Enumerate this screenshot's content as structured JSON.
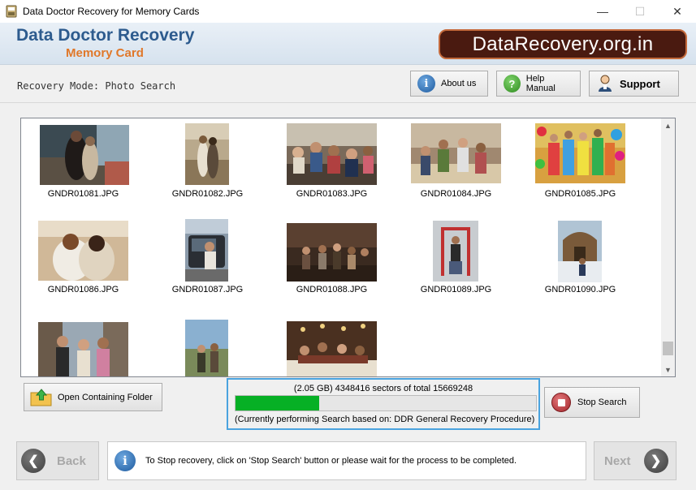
{
  "window": {
    "title": "Data Doctor Recovery for Memory Cards",
    "minimize": "—",
    "maximize": "☐",
    "close": "✕"
  },
  "header": {
    "brand_line1": "Data Doctor Recovery",
    "brand_line2": "Memory Card",
    "site_badge": "DataRecovery.org.in",
    "colors": {
      "brand_blue": "#2d5b8e",
      "brand_orange": "#e0782a",
      "badge_bg": "#4a1a10"
    }
  },
  "mode": {
    "label": "Recovery Mode: Photo Search"
  },
  "toolbar": {
    "about_label": "About us",
    "help_label": "Help Manual",
    "support_label": "Support",
    "about_icon": "info-icon",
    "help_icon": "question-icon",
    "support_icon": "person-icon"
  },
  "gallery": {
    "files": [
      {
        "name": "GNDR01081.JPG"
      },
      {
        "name": "GNDR01082.JPG"
      },
      {
        "name": "GNDR01083.JPG"
      },
      {
        "name": "GNDR01084.JPG"
      },
      {
        "name": "GNDR01085.JPG"
      },
      {
        "name": "GNDR01086.JPG"
      },
      {
        "name": "GNDR01087.JPG"
      },
      {
        "name": "GNDR01088.JPG"
      },
      {
        "name": "GNDR01089.JPG"
      },
      {
        "name": "GNDR01090.JPG"
      },
      {
        "name": ""
      },
      {
        "name": ""
      },
      {
        "name": ""
      }
    ],
    "scroll_up": "▲",
    "scroll_down": "▼"
  },
  "actions": {
    "open_folder_label": "Open Containing Folder",
    "stop_label": "Stop Search"
  },
  "progress": {
    "stats_text": "(2.05 GB) 4348416  sectors  of  total  15669248",
    "status_text": "(Currently performing Search based on:  DDR General Recovery Procedure)",
    "sectors_done": 4348416,
    "sectors_total": 15669248,
    "fill_color": "#06b025",
    "border_color": "#4aa3df"
  },
  "footer": {
    "back_label": "Back",
    "next_label": "Next",
    "back_arrow": "❮",
    "next_arrow": "❯",
    "info_text": "To Stop recovery, click on 'Stop Search' button or please wait for the process to be completed."
  }
}
